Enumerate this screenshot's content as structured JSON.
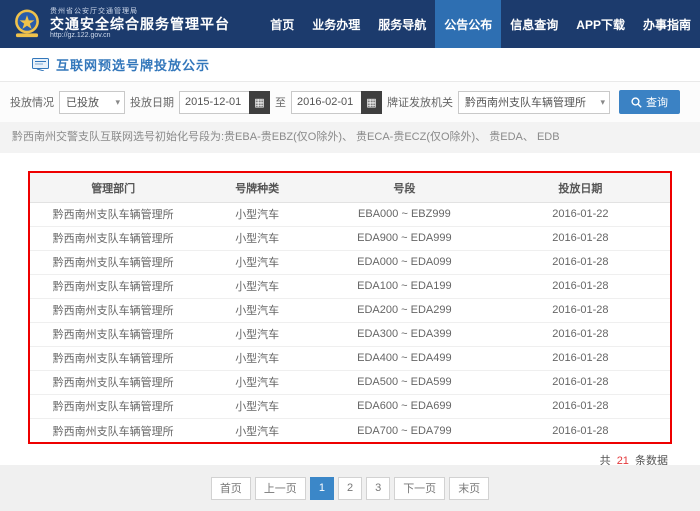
{
  "header": {
    "agency": "贵州省公安厅交通管理局",
    "platform": "交通安全综合服务管理平台",
    "url": "http://gz.122.gov.cn",
    "nav": [
      {
        "key": "home",
        "label": "首页",
        "active": false
      },
      {
        "key": "business",
        "label": "业务办理",
        "active": false
      },
      {
        "key": "service-guide",
        "label": "服务导航",
        "active": false
      },
      {
        "key": "announcements",
        "label": "公告公布",
        "active": true
      },
      {
        "key": "info-query",
        "label": "信息查询",
        "active": false
      },
      {
        "key": "app-download",
        "label": "APP下载",
        "active": false
      },
      {
        "key": "work-guide",
        "label": "办事指南",
        "active": false
      }
    ]
  },
  "page": {
    "title": "互联网预选号牌投放公示"
  },
  "filters": {
    "status_label": "投放情况",
    "status_value": "已投放",
    "date_label": "投放日期",
    "date_from": "2015-12-01",
    "to_label": "至",
    "date_to": "2016-02-01",
    "org_label": "牌证发放机关",
    "org_value": "黔西南州支队车辆管理所",
    "search_label": "查询"
  },
  "notice": "黔西南州交警支队互联网选号初始化号段为:贵EBA-贵EBZ(仅O除外)、 贵ECA-贵ECZ(仅O除外)、 贵EDA、 EDB",
  "table": {
    "columns": [
      "管理部门",
      "号牌种类",
      "号段",
      "投放日期"
    ],
    "rows": [
      {
        "dept": "黔西南州支队车辆管理所",
        "plate_type": "小型汽车",
        "range": "EBA000 ~ EBZ999",
        "date": "2016-01-22"
      },
      {
        "dept": "黔西南州支队车辆管理所",
        "plate_type": "小型汽车",
        "range": "EDA900 ~ EDA999",
        "date": "2016-01-28"
      },
      {
        "dept": "黔西南州支队车辆管理所",
        "plate_type": "小型汽车",
        "range": "EDA000 ~ EDA099",
        "date": "2016-01-28"
      },
      {
        "dept": "黔西南州支队车辆管理所",
        "plate_type": "小型汽车",
        "range": "EDA100 ~ EDA199",
        "date": "2016-01-28"
      },
      {
        "dept": "黔西南州支队车辆管理所",
        "plate_type": "小型汽车",
        "range": "EDA200 ~ EDA299",
        "date": "2016-01-28"
      },
      {
        "dept": "黔西南州支队车辆管理所",
        "plate_type": "小型汽车",
        "range": "EDA300 ~ EDA399",
        "date": "2016-01-28"
      },
      {
        "dept": "黔西南州支队车辆管理所",
        "plate_type": "小型汽车",
        "range": "EDA400 ~ EDA499",
        "date": "2016-01-28"
      },
      {
        "dept": "黔西南州支队车辆管理所",
        "plate_type": "小型汽车",
        "range": "EDA500 ~ EDA599",
        "date": "2016-01-28"
      },
      {
        "dept": "黔西南州支队车辆管理所",
        "plate_type": "小型汽车",
        "range": "EDA600 ~ EDA699",
        "date": "2016-01-28"
      },
      {
        "dept": "黔西南州支队车辆管理所",
        "plate_type": "小型汽车",
        "range": "EDA700 ~ EDA799",
        "date": "2016-01-28"
      }
    ]
  },
  "summary": {
    "prefix": "共",
    "count": "21",
    "suffix": "条数据"
  },
  "pagination": [
    {
      "key": "first",
      "label": "首页",
      "active": false
    },
    {
      "key": "prev",
      "label": "上一页",
      "active": false
    },
    {
      "key": "page-1",
      "label": "1",
      "active": true
    },
    {
      "key": "page-2",
      "label": "2",
      "active": false
    },
    {
      "key": "page-3",
      "label": "3",
      "active": false
    },
    {
      "key": "next",
      "label": "下一页",
      "active": false
    },
    {
      "key": "last",
      "label": "末页",
      "active": false
    }
  ],
  "icons": {
    "search-icon": "magnifier",
    "calendar-icon": "▦",
    "chevron-down-icon": "▾",
    "police-badge-logo": "badge",
    "bulletin-icon": "document"
  },
  "colors": {
    "header_bg": "#1c3b6d",
    "nav_active": "#2e6fb2",
    "title_blue": "#3377bb",
    "button_blue": "#3b82c4",
    "table_highlight_border": "#ee0000",
    "count_red": "#e4393c",
    "footer_bg": "#f0f0f0"
  }
}
